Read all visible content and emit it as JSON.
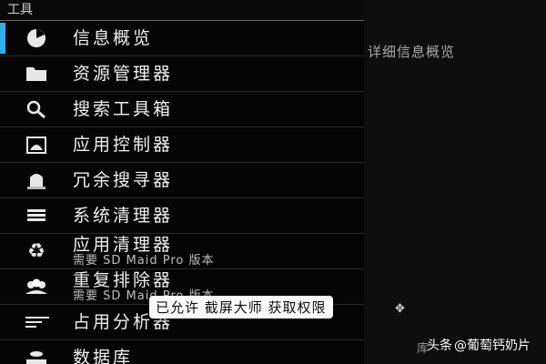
{
  "drawer": {
    "section_title": "工具",
    "items": [
      {
        "label": "信息概览",
        "icon": "pie-chart-icon",
        "selected": true
      },
      {
        "label": "资源管理器",
        "icon": "folder-icon"
      },
      {
        "label": "搜索工具箱",
        "icon": "search-icon"
      },
      {
        "label": "应用控制器",
        "icon": "android-icon"
      },
      {
        "label": "冗余搜寻器",
        "icon": "tombstone-icon"
      },
      {
        "label": "系统清理器",
        "icon": "list-icon"
      },
      {
        "label": "应用清理器",
        "sub": "需要 SD Maid Pro 版本",
        "icon": "recycle-icon"
      },
      {
        "label": "重复排除器",
        "sub": "需要 SD Maid Pro 版本",
        "icon": "duplicates-icon"
      },
      {
        "label": "占用分析器",
        "icon": "lines-icon"
      },
      {
        "label": "数据库",
        "icon": "database-icon"
      }
    ]
  },
  "content": {
    "title": "详细信息概览",
    "bottom_text": "库"
  },
  "toast": "已允许 截屏大师 获取权限",
  "watermark": {
    "brand": "头条",
    "author": "@葡萄钙奶片"
  },
  "colors": {
    "accent": "#2fb0e8",
    "background": "#050505"
  }
}
